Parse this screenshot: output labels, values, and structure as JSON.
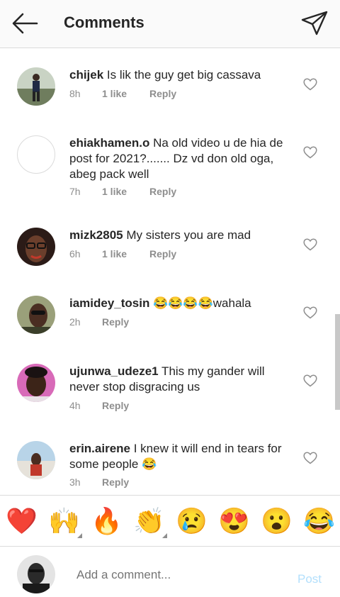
{
  "header": {
    "title": "Comments",
    "back_icon": "arrow-left-icon",
    "send_icon": "direct-message-icon"
  },
  "comments": [
    {
      "username": "chijek",
      "text": " Is lik the guy get big cassava",
      "time": "8h",
      "likes": "1 like",
      "reply": "Reply"
    },
    {
      "username": "ehiakhamen.o",
      "text": " Na old video u de hia de post for 2021?....... Dz vd don old oga, abeg pack well",
      "time": "7h",
      "likes": "1 like",
      "reply": "Reply"
    },
    {
      "username": "mizk2805",
      "text": " My sisters you are mad",
      "time": "6h",
      "likes": "1 like",
      "reply": "Reply"
    },
    {
      "username": "iamidey_tosin",
      "text": " 😂😂😂😂wahala",
      "time": "2h",
      "likes": "",
      "reply": "Reply"
    },
    {
      "username": "ujunwa_udeze1",
      "text": " This my gander will never stop disgracing us",
      "time": "4h",
      "likes": "",
      "reply": "Reply"
    },
    {
      "username": "erin.airene",
      "text": " I knew it will end in tears for some people 😂",
      "time": "3h",
      "likes": "",
      "reply": "Reply"
    }
  ],
  "emoji_bar": [
    "❤️",
    "🙌",
    "🔥",
    "👏",
    "😢",
    "😍",
    "😮",
    "😂"
  ],
  "compose": {
    "placeholder": "Add a comment...",
    "post_label": "Post"
  },
  "colors": {
    "heart": "#ed4956",
    "link_blue": "#b2dffc",
    "meta_gray": "#8e8e8e"
  }
}
